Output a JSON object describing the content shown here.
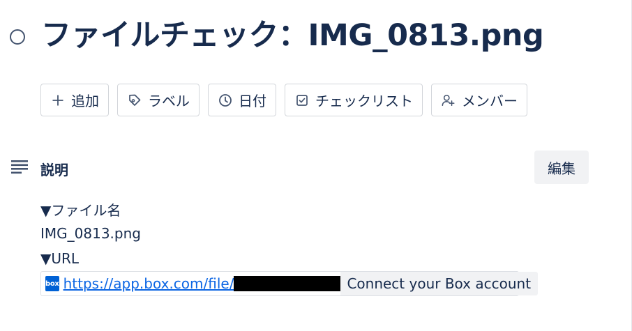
{
  "card": {
    "title": "ファイルチェック：IMG_0813.png"
  },
  "actions": [
    {
      "label": "追加",
      "icon": "plus-icon"
    },
    {
      "label": "ラベル",
      "icon": "tag-icon"
    },
    {
      "label": "日付",
      "icon": "clock-icon"
    },
    {
      "label": "チェックリスト",
      "icon": "checkbox-icon"
    },
    {
      "label": "メンバー",
      "icon": "add-member-icon"
    }
  ],
  "description": {
    "heading": "説明",
    "icon": "text-lines-icon",
    "edit_label": "編集",
    "lines": [
      "▼ファイル名",
      "IMG_0813.png",
      "▼URL"
    ],
    "link": {
      "logo_text": "box",
      "url_text": "https://app.box.com/file/",
      "redacted": true,
      "connect_label": "Connect your Box account"
    }
  },
  "colors": {
    "text": "#172b4d",
    "link": "#0c66e4",
    "box_brand": "#0061d5",
    "button_bg": "#f1f2f4",
    "border": "#d2d5da"
  }
}
